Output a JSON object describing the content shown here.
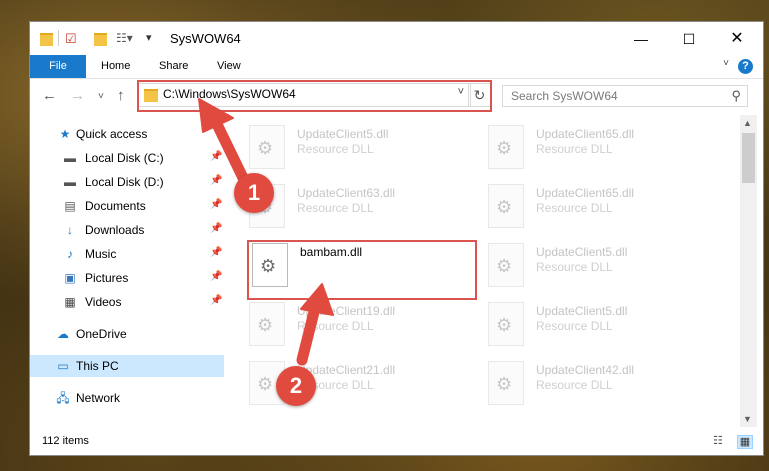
{
  "window": {
    "title": "SysWOW64"
  },
  "ribbon": {
    "file": "File",
    "home": "Home",
    "share": "Share",
    "view": "View",
    "help": "?"
  },
  "address": {
    "path": "C:\\Windows\\SysWOW64"
  },
  "search": {
    "placeholder": "Search SysWOW64"
  },
  "sidebar": {
    "quick_access": "Quick access",
    "items": [
      {
        "label": "Local Disk (C:)"
      },
      {
        "label": "Local Disk (D:)"
      },
      {
        "label": "Documents"
      },
      {
        "label": "Downloads"
      },
      {
        "label": "Music"
      },
      {
        "label": "Pictures"
      },
      {
        "label": "Videos"
      }
    ],
    "onedrive": "OneDrive",
    "this_pc": "This PC",
    "network": "Network"
  },
  "files": [
    {
      "name": "UpdateClient5.dll",
      "type": "Resource DLL"
    },
    {
      "name": "UpdateClient65.dll",
      "type": "Resource DLL"
    },
    {
      "name": "UpdateClient63.dll",
      "type": "Resource DLL"
    },
    {
      "name": "UpdateClient65.dll",
      "type": "Resource DLL"
    },
    {
      "name": "bambam.dll",
      "type": ""
    },
    {
      "name": "UpdateClient5.dll",
      "type": "Resource DLL"
    },
    {
      "name": "UpdateClient19.dll",
      "type": "Resource DLL"
    },
    {
      "name": "UpdateClient5.dll",
      "type": "Resource DLL"
    },
    {
      "name": "UpdateClient21.dll",
      "type": "Resource DLL"
    },
    {
      "name": "UpdateClient42.dll",
      "type": "Resource DLL"
    }
  ],
  "status": {
    "count": "112 items"
  },
  "callouts": {
    "one": "1",
    "two": "2"
  },
  "colors": {
    "accent": "#1979ca",
    "highlight": "#d9534f",
    "callout": "#e04a3f",
    "selection": "#cce8ff"
  }
}
